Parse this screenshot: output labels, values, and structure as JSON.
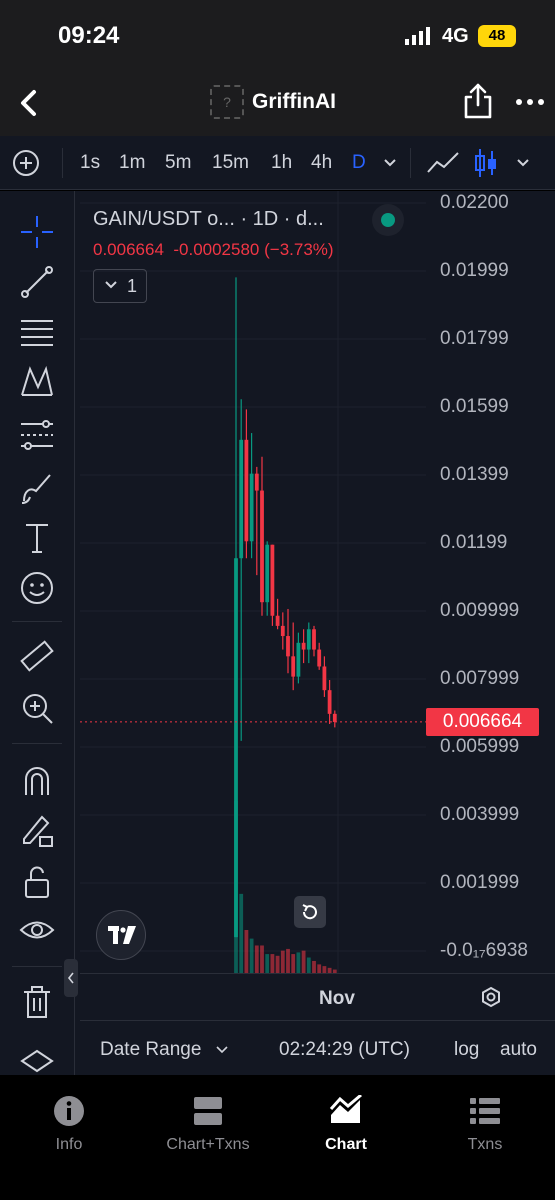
{
  "status": {
    "time": "09:24",
    "network": "4G",
    "battery": "48"
  },
  "nav": {
    "logo_placeholder": "?",
    "title": "GriffinAI"
  },
  "timeframes": {
    "items": [
      "1s",
      "1m",
      "5m",
      "15m",
      "1h",
      "4h",
      "D"
    ],
    "active": "D"
  },
  "legend": {
    "title": "GAIN/USDT o...  · 1D · d...",
    "price": "0.006664",
    "change": "-0.0002580",
    "change_pct": "(−3.73%)",
    "indicator_count": "1"
  },
  "price_axis": {
    "labels": [
      "0.02200",
      "0.01999",
      "0.01799",
      "0.01599",
      "0.01399",
      "0.01199",
      "0.009999",
      "0.007999",
      "0.005999",
      "0.003999",
      "0.001999",
      "-0.0₁₇6938"
    ],
    "current": "0.006664"
  },
  "time_axis": {
    "label": "Nov"
  },
  "bottom": {
    "date_range": "Date Range",
    "clock": "02:24:29 (UTC)",
    "log": "log",
    "auto": "auto"
  },
  "tabs": [
    {
      "label": "Info",
      "icon": "info-icon"
    },
    {
      "label": "Chart+Txns",
      "icon": "split-view-icon"
    },
    {
      "label": "Chart",
      "icon": "area-chart-icon",
      "active": true
    },
    {
      "label": "Txns",
      "icon": "list-icon"
    }
  ],
  "colors": {
    "up": "#089981",
    "down": "#f23645",
    "accent": "#2962ff",
    "background": "#131722"
  },
  "chart_data": {
    "type": "candlestick",
    "symbol": "GAIN/USDT",
    "interval": "1D",
    "ylim": [
      -0.0011,
      0.0221
    ],
    "candles": [
      {
        "o": 0.0003,
        "h": 0.0198,
        "l": 0.0003,
        "c": 0.0115
      },
      {
        "o": 0.0115,
        "h": 0.0162,
        "l": 0.0061,
        "c": 0.015
      },
      {
        "o": 0.015,
        "h": 0.0159,
        "l": 0.0115,
        "c": 0.012
      },
      {
        "o": 0.012,
        "h": 0.0152,
        "l": 0.0115,
        "c": 0.014
      },
      {
        "o": 0.014,
        "h": 0.0142,
        "l": 0.011,
        "c": 0.0135
      },
      {
        "o": 0.0135,
        "h": 0.0145,
        "l": 0.0098,
        "c": 0.0102
      },
      {
        "o": 0.0102,
        "h": 0.012,
        "l": 0.0098,
        "c": 0.0119
      },
      {
        "o": 0.0119,
        "h": 0.0119,
        "l": 0.0095,
        "c": 0.0098
      },
      {
        "o": 0.0098,
        "h": 0.0103,
        "l": 0.0094,
        "c": 0.0095
      },
      {
        "o": 0.0095,
        "h": 0.0099,
        "l": 0.0088,
        "c": 0.0092
      },
      {
        "o": 0.0092,
        "h": 0.01,
        "l": 0.0081,
        "c": 0.0086
      },
      {
        "o": 0.0086,
        "h": 0.0096,
        "l": 0.0076,
        "c": 0.008
      },
      {
        "o": 0.008,
        "h": 0.0093,
        "l": 0.0078,
        "c": 0.009
      },
      {
        "o": 0.009,
        "h": 0.0094,
        "l": 0.0084,
        "c": 0.0088
      },
      {
        "o": 0.0088,
        "h": 0.0096,
        "l": 0.0084,
        "c": 0.0094
      },
      {
        "o": 0.0094,
        "h": 0.0095,
        "l": 0.0086,
        "c": 0.0088
      },
      {
        "o": 0.0088,
        "h": 0.009,
        "l": 0.0082,
        "c": 0.0083
      },
      {
        "o": 0.0083,
        "h": 0.0086,
        "l": 0.0074,
        "c": 0.0076
      },
      {
        "o": 0.0076,
        "h": 0.0079,
        "l": 0.0066,
        "c": 0.0069
      },
      {
        "o": 0.0069,
        "h": 0.007,
        "l": 0.0065,
        "c": 0.00666
      }
    ],
    "volume_relative": [
      1.0,
      0.46,
      0.25,
      0.2,
      0.16,
      0.16,
      0.11,
      0.11,
      0.1,
      0.13,
      0.14,
      0.11,
      0.12,
      0.13,
      0.09,
      0.07,
      0.05,
      0.04,
      0.03,
      0.02
    ]
  }
}
